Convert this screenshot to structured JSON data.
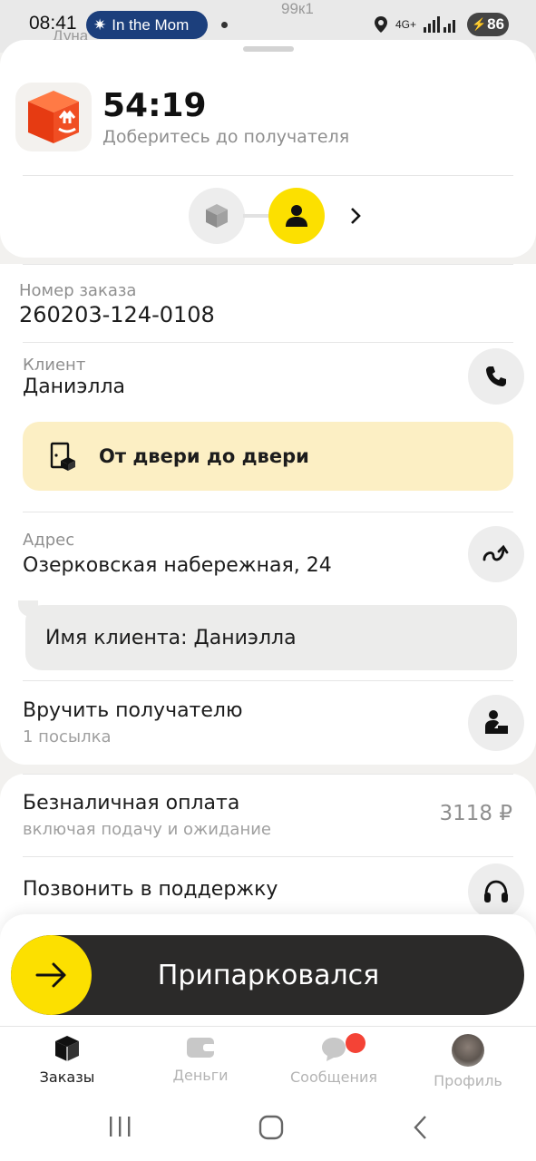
{
  "status_bar": {
    "time": "08:41",
    "now_playing": "In the Mom",
    "network": "4G+",
    "battery": "86"
  },
  "map_labels": [
    "99к1",
    "Дуна"
  ],
  "header": {
    "timer": "54:19",
    "subtitle": "Доберитесь до получателя",
    "progress_steps": [
      {
        "icon": "package-icon",
        "state": "done"
      },
      {
        "icon": "person-icon",
        "state": "current"
      }
    ]
  },
  "order": {
    "number_label": "Номер заказа",
    "number_value": "260203-124-0108"
  },
  "client": {
    "label": "Клиент",
    "name": "Даниэлла"
  },
  "delivery_tag": "От двери до двери",
  "address": {
    "label": "Адрес",
    "value": "Озерковская набережная, 24"
  },
  "client_note": "Имя клиента: Даниэлла",
  "handover": {
    "title": "Вручить получателю",
    "subtitle": "1 посылка"
  },
  "payment": {
    "title": "Безналичная оплата",
    "subtitle": "включая подачу и ожидание",
    "price": "3118 ₽"
  },
  "support": {
    "label": "Позвонить в поддержку"
  },
  "action": {
    "label": "Припарковался"
  },
  "tabs": [
    {
      "label": "Заказы",
      "icon": "orders-cube-icon",
      "active": true
    },
    {
      "label": "Деньги",
      "icon": "wallet-icon",
      "active": false
    },
    {
      "label": "Сообщения",
      "icon": "chat-bubble-icon",
      "active": false
    },
    {
      "label": "Профиль",
      "icon": "avatar",
      "active": false
    }
  ],
  "colors": {
    "accent_yellow": "#fce000",
    "tag_background": "#fcefc4",
    "action_dark": "#2b2a29",
    "badge_red": "#f44336",
    "app_icon_orange": "#f04e23"
  }
}
